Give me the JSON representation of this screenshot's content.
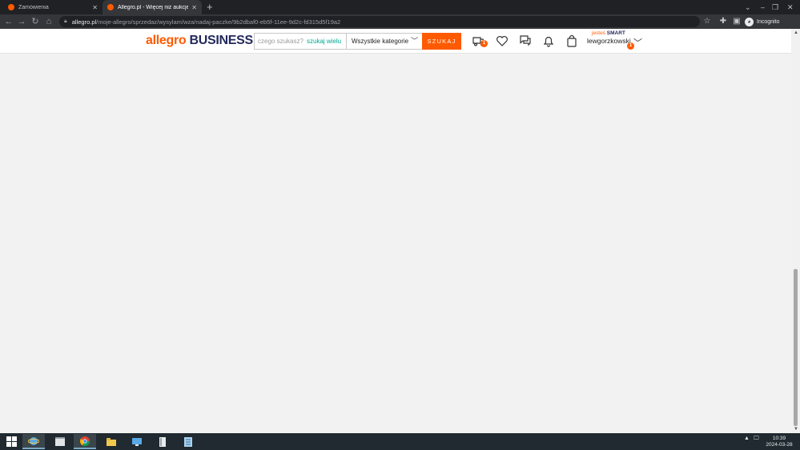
{
  "browser": {
    "tabs": [
      {
        "title": "Zamówienia",
        "active": false
      },
      {
        "title": "Allegro.pl - Więcej niż aukcje. Najlepsze oferty",
        "active": true
      }
    ],
    "url_domain": "allegro.pl",
    "url_path": "/moje-allegro/sprzedaz/wysylam/wza/nadaj-paczke/9b2dbaf0-eb5f-11ee-9d2c-fd315d5f19a2",
    "profile_label": "Incognito",
    "icons": {
      "back": "back-arrow-icon",
      "forward": "forward-arrow-icon",
      "reload": "reload-icon",
      "home": "home-icon",
      "lock": "lock-icon",
      "bookmark": "star-icon",
      "extensions": "puzzle-icon",
      "sidepanel": "side-panel-icon"
    }
  },
  "site": {
    "logo_part1": "allegro",
    "logo_part2": " BUSINESS",
    "search_placeholder": "czego szukasz?",
    "multi_search_label": "szukaj wielu",
    "category_selected": "Wszystkie kategorie",
    "search_button": "SZUKAJ",
    "cart_badge": "1",
    "user_badge": "1",
    "smart_prefix": "jesteś ",
    "smart_label": "SMART",
    "username": "lewgorzkowski",
    "brand_color": "#ff5a00",
    "secondary_color": "#242a5c",
    "icons": [
      "delivery-truck-icon",
      "heart-icon",
      "messages-icon",
      "bell-icon",
      "bag-icon"
    ]
  },
  "taskbar": {
    "time": "10:39",
    "date": "2024-03-28",
    "apps": [
      "start-icon",
      "internet-explorer-icon",
      "movies-tv-icon",
      "chrome-icon",
      "file-explorer-icon",
      "network-icon",
      "terminal-icon",
      "notepad-icon"
    ]
  }
}
